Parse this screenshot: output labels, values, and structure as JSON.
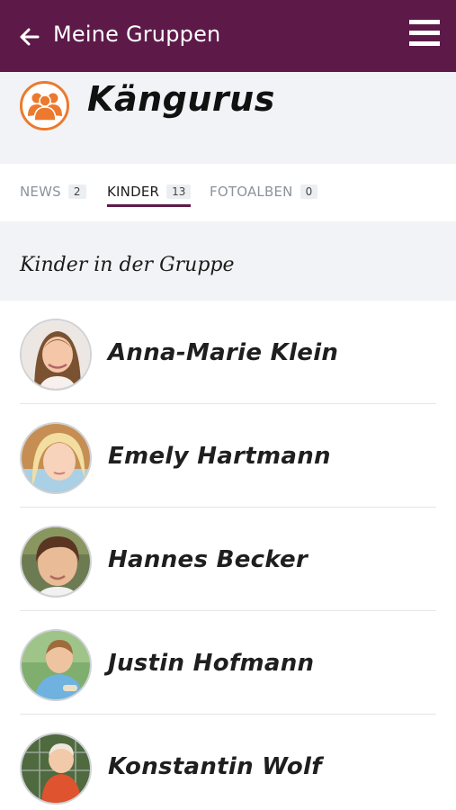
{
  "appbar": {
    "title": "Meine Gruppen",
    "back_icon": "arrow-left-icon",
    "menu_icon": "hamburger-menu-icon",
    "color": "#5d1a49"
  },
  "group": {
    "name": "Kängurus",
    "icon": "group-people-icon",
    "icon_color": "#ec7a2e"
  },
  "tabs": [
    {
      "label": "NEWS",
      "count": "2",
      "active": false
    },
    {
      "label": "KINDER",
      "count": "13",
      "active": true
    },
    {
      "label": "FOTOALBEN",
      "count": "0",
      "active": false
    }
  ],
  "section": {
    "title": "Kinder in der Gruppe"
  },
  "children": [
    {
      "name": "Anna-Marie Klein",
      "avatar": "child-photo"
    },
    {
      "name": "Emely Hartmann",
      "avatar": "child-photo"
    },
    {
      "name": "Hannes Becker",
      "avatar": "child-photo"
    },
    {
      "name": "Justin Hofmann",
      "avatar": "child-photo"
    },
    {
      "name": "Konstantin Wolf",
      "avatar": "child-photo"
    }
  ]
}
